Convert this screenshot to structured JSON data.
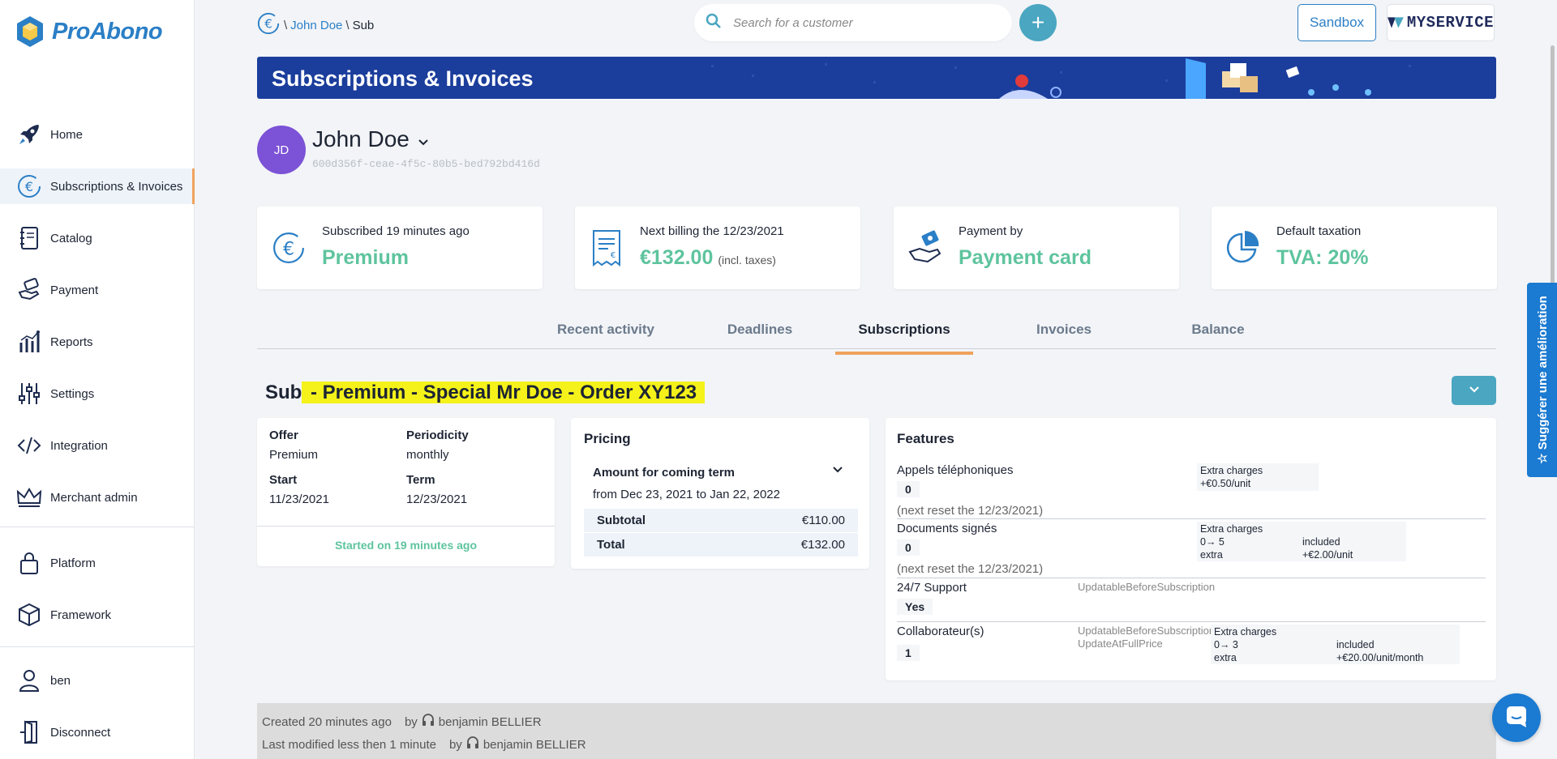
{
  "brand": {
    "name": "ProAbono",
    "accent": "#2b7fc6",
    "green": "#5ec49e",
    "orange": "#f0a25d"
  },
  "sidebar": {
    "items": [
      {
        "label": "Home",
        "icon": "rocket-icon"
      },
      {
        "label": "Subscriptions & Invoices",
        "icon": "euro-cycle-icon",
        "active": true
      },
      {
        "label": "Catalog",
        "icon": "notebook-icon"
      },
      {
        "label": "Payment",
        "icon": "hand-card-icon"
      },
      {
        "label": "Reports",
        "icon": "chart-icon"
      },
      {
        "label": "Settings",
        "icon": "sliders-icon"
      },
      {
        "label": "Integration",
        "icon": "code-icon"
      },
      {
        "label": "Merchant admin",
        "icon": "crown-icon"
      }
    ],
    "platform_items": [
      {
        "label": "Platform",
        "icon": "lock-icon"
      },
      {
        "label": "Framework",
        "icon": "box-icon"
      }
    ],
    "user_items": [
      {
        "label": "ben",
        "icon": "user-icon"
      },
      {
        "label": "Disconnect",
        "icon": "door-icon"
      }
    ]
  },
  "breadcrumb": {
    "sep": "\\",
    "customer": "John Doe",
    "current": "Sub"
  },
  "search": {
    "placeholder": "Search for a customer"
  },
  "topbar": {
    "add_label": "+",
    "sandbox_label": "Sandbox",
    "service_name": "MYSERVICE"
  },
  "banner": {
    "title": "Subscriptions & Invoices"
  },
  "customer": {
    "initials": "JD",
    "name": "John Doe",
    "id": "600d356f-ceae-4f5c-80b5-bed792bd416d"
  },
  "cards": [
    {
      "label": "Subscribed 19 minutes ago",
      "value": "Premium",
      "note": "",
      "icon": "euro-cycle-icon"
    },
    {
      "label": "Next billing the 12/23/2021",
      "value": "€132.00",
      "note": "(incl. taxes)",
      "icon": "receipt-icon"
    },
    {
      "label": "Payment by",
      "value": "Payment card",
      "note": "",
      "icon": "hand-card-icon"
    },
    {
      "label": "Default taxation",
      "value": "TVA: 20%",
      "note": "",
      "icon": "pie-icon"
    }
  ],
  "tabs": [
    {
      "label": "Recent activity"
    },
    {
      "label": "Deadlines"
    },
    {
      "label": "Subscriptions",
      "active": true
    },
    {
      "label": "Invoices"
    },
    {
      "label": "Balance"
    }
  ],
  "subscription": {
    "title_prefix": "Sub",
    "title_highlight": " - Premium - Special Mr Doe - Order XY123",
    "offer_label": "Offer",
    "offer_value": "Premium",
    "periodicity_label": "Periodicity",
    "periodicity_value": "monthly",
    "start_label": "Start",
    "start_value": "11/23/2021",
    "term_label": "Term",
    "term_value": "12/23/2021",
    "started_text": "Started on 19 minutes ago"
  },
  "pricing": {
    "title": "Pricing",
    "coming_label": "Amount for coming term",
    "range": "from Dec 23, 2021 to Jan 22, 2022",
    "subtotal_label": "Subtotal",
    "subtotal_value": "€110.00",
    "total_label": "Total",
    "total_value": "€132.00"
  },
  "features": {
    "title": "Features",
    "items": [
      {
        "name": "Appels téléphoniques",
        "value": "0",
        "reset": "(next reset the 12/23/2021)",
        "extra_title": "Extra charges",
        "extra_line1": "+€0.50/unit"
      },
      {
        "name": "Documents signés",
        "value": "0",
        "reset": "(next reset the 12/23/2021)",
        "extra_title": "Extra charges",
        "extra_range": "0→ 5",
        "extra_included": "included",
        "extra_word": "extra",
        "extra_price": "+€2.00/unit"
      },
      {
        "name": "24/7 Support",
        "value": "Yes",
        "flags": "UpdatableBeforeSubscription"
      },
      {
        "name": "Collaborateur(s)",
        "value": "1",
        "flags1": "UpdatableBeforeSubscription,",
        "flags2": "UpdateAtFullPrice",
        "extra_title": "Extra charges",
        "extra_range": "0→ 3",
        "extra_included": "included",
        "extra_word": "extra",
        "extra_price": "+€20.00/unit/month"
      }
    ]
  },
  "footer": {
    "created_label": "Created",
    "created_time": "20 minutes ago",
    "by": "by",
    "created_user": "benjamin BELLIER",
    "modified_label": "Last modified",
    "modified_time": "less then 1 minute",
    "modified_user": "benjamin BELLIER"
  },
  "suggest": {
    "label": "Suggérer une amélioration"
  }
}
